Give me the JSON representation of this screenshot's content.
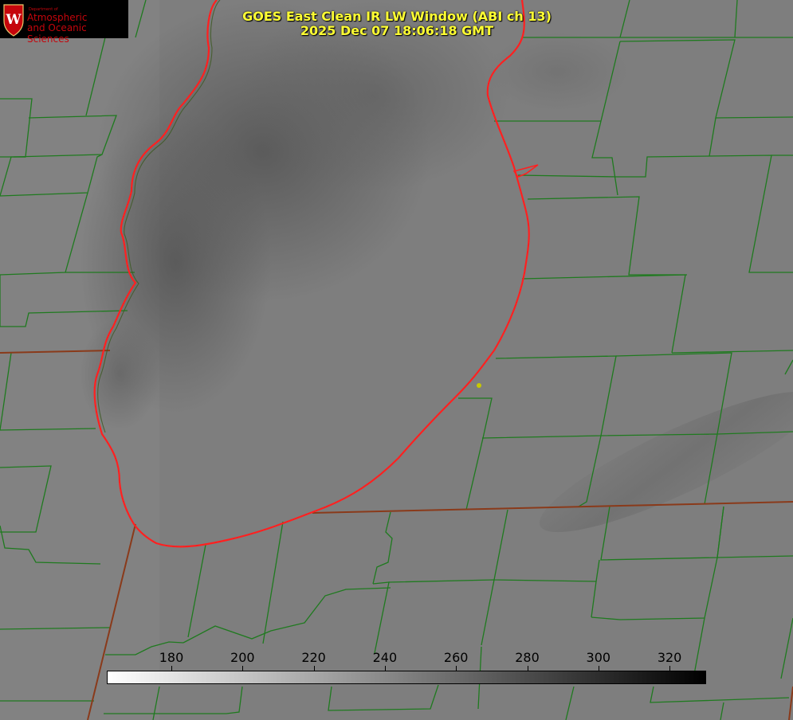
{
  "header": {
    "title": "GOES East Clean IR LW Window (ABI ch 13)",
    "timestamp": "2025 Dec 07 18:06:18 GMT"
  },
  "logo": {
    "department": "Department of",
    "line1": "Atmospheric",
    "line2": "and Oceanic Sciences",
    "icon": "uw-crest-icon",
    "color": "#c5050c"
  },
  "colorbar": {
    "ticks": [
      "180",
      "200",
      "220",
      "240",
      "260",
      "280",
      "300",
      "320"
    ],
    "gradient_start": "#ffffff",
    "gradient_end": "#000000"
  },
  "colors": {
    "title_text": "#ffff33",
    "county_lines": "#1f7a1f",
    "state_lines": "#8a3a1a",
    "lake_outline": "#ff2020",
    "marker": "#c8c800"
  }
}
